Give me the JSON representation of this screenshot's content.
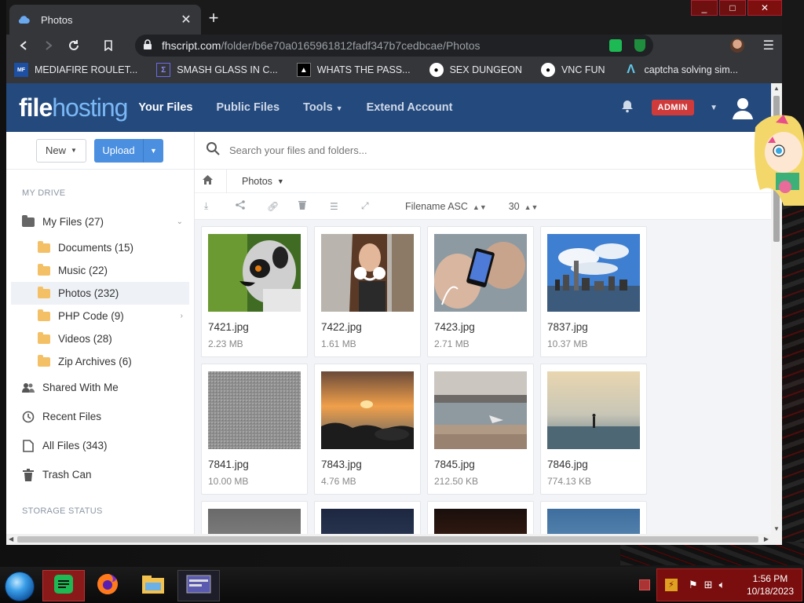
{
  "browser": {
    "tab_title": "Photos",
    "tab_close": "✕",
    "new_tab": "+",
    "url_host": "fhscript.com",
    "url_path": "/folder/b6e70a0165961812fadf347b7cedbcae/Photos",
    "bookmarks": [
      {
        "label": "MEDIAFIRE ROULET...",
        "icon": "mediafire-icon"
      },
      {
        "label": "SMASH GLASS IN C...",
        "icon": "glass-icon"
      },
      {
        "label": "WHATS THE PASS...",
        "icon": "lock-icon"
      },
      {
        "label": "SEX DUNGEON",
        "icon": "github-icon"
      },
      {
        "label": "VNC FUN",
        "icon": "github-icon"
      },
      {
        "label": "captcha solving sim...",
        "icon": "lambda-icon"
      }
    ]
  },
  "app": {
    "logo_part1": "file",
    "logo_part2": "hosting",
    "nav": [
      "Your Files",
      "Public Files",
      "Tools",
      "Extend Account"
    ],
    "admin_badge": "ADMIN"
  },
  "sidebar": {
    "new_label": "New",
    "upload_label": "Upload",
    "my_drive": "MY DRIVE",
    "items": [
      {
        "label": "My Files (27)"
      },
      {
        "label": "Documents (15)"
      },
      {
        "label": "Music (22)"
      },
      {
        "label": "Photos (232)"
      },
      {
        "label": "PHP Code (9)"
      },
      {
        "label": "Videos (28)"
      },
      {
        "label": "Zip Archives (6)"
      },
      {
        "label": "Shared With Me"
      },
      {
        "label": "Recent Files"
      },
      {
        "label": "All Files (343)"
      },
      {
        "label": "Trash Can"
      }
    ],
    "storage_status": "STORAGE STATUS"
  },
  "main": {
    "search_placeholder": "Search your files and folders...",
    "breadcrumb": "Photos",
    "sort_label": "Filename ASC",
    "per_page": "30",
    "files": [
      {
        "name": "7421.jpg",
        "size": "2.23 MB"
      },
      {
        "name": "7422.jpg",
        "size": "1.61 MB"
      },
      {
        "name": "7423.jpg",
        "size": "2.71 MB"
      },
      {
        "name": "7837.jpg",
        "size": "10.37 MB"
      },
      {
        "name": "7841.jpg",
        "size": "10.00 MB"
      },
      {
        "name": "7843.jpg",
        "size": "4.76 MB"
      },
      {
        "name": "7845.jpg",
        "size": "212.50 KB"
      },
      {
        "name": "7846.jpg",
        "size": "774.13 KB"
      }
    ]
  },
  "taskbar": {
    "time": "1:56 PM",
    "date": "10/18/2023"
  }
}
